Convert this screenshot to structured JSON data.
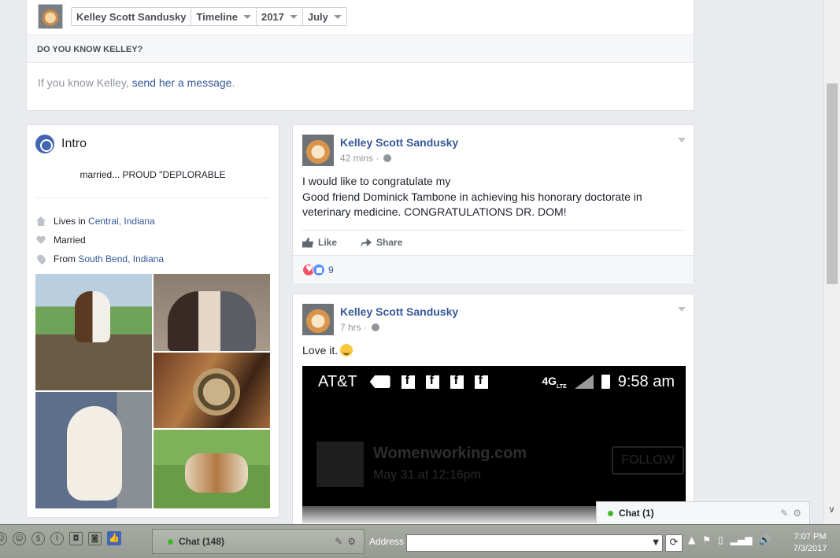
{
  "timeline_bar": {
    "crumbs": [
      "Kelley Scott Sandusky",
      "Timeline",
      "2017",
      "July"
    ]
  },
  "know": {
    "header": "DO YOU KNOW KELLEY?",
    "prefix": "If you know Kelley, ",
    "link": "send her a message",
    "suffix": "."
  },
  "intro": {
    "title": "Intro",
    "bio": "married... PROUD \"DEPLORABLE",
    "facts": [
      {
        "icon": "home-icon",
        "prefix": "Lives in ",
        "link": "Central, Indiana"
      },
      {
        "icon": "heart-icon",
        "prefix": "Married",
        "link": ""
      },
      {
        "icon": "location-pin-icon",
        "prefix": "From ",
        "link": "South Bend, Indiana"
      }
    ]
  },
  "posts": [
    {
      "author": "Kelley Scott Sandusky",
      "time": "42 mins",
      "text_line1": "I would like to congratulate my",
      "text_line2": "Good friend Dominick Tambone in achieving his honorary doctorate in veterinary medicine. CONGRATULATIONS DR. DOM!",
      "like_label": "Like",
      "share_label": "Share",
      "reaction_count": "9"
    },
    {
      "author": "Kelley Scott Sandusky",
      "time": "7 hrs",
      "text": "Love it.",
      "screenshot": {
        "carrier": "AT&T",
        "network": "4G",
        "network_sub": "LTE",
        "clock": "9:58 am",
        "faded_name": "Womenworking.com",
        "faded_date": "May 31 at 12:16pm",
        "faded_button": "FOLLOW"
      }
    }
  ],
  "chat_tab": {
    "label": "Chat (1)"
  },
  "taskbar": {
    "chat_label": "Chat (148)",
    "address_label": "Address",
    "address_value": "",
    "time": "7:07 PM",
    "date": "7/3/2017"
  },
  "colors": {
    "facebook_blue": "#4267b2",
    "link": "#365899",
    "page_bg": "#e9ebee"
  }
}
